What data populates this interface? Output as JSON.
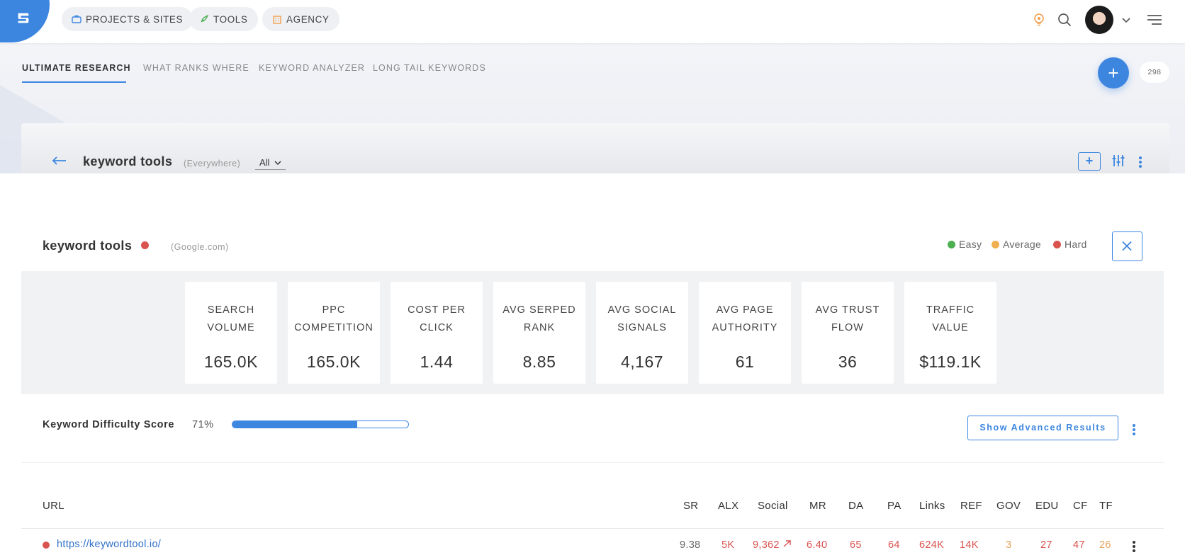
{
  "colors": {
    "accent": "#3d86e0",
    "easy": "#4caf50",
    "average": "#f0b04f",
    "hard": "#d9534f",
    "hard_text": "#d9534f",
    "avg_text": "#e8a25a",
    "link": "#2f6fc8"
  },
  "topnav": {
    "logo_icon": "brand-logo-icon",
    "items": [
      {
        "label": "PROJECTS & SITES",
        "icon": "briefcase-icon"
      },
      {
        "label": "TOOLS",
        "icon": "rocket-icon"
      },
      {
        "label": "AGENCY",
        "icon": "building-icon"
      }
    ],
    "right_icons": [
      "lightbulb-icon",
      "search-icon",
      "avatar",
      "chevron-down-icon",
      "menu-icon"
    ]
  },
  "tabs": [
    "ULTIMATE RESEARCH",
    "WHAT RANKS WHERE",
    "KEYWORD ANALYZER",
    "LONG TAIL KEYWORDS"
  ],
  "active_tab": "ULTIMATE RESEARCH",
  "fab": {
    "label": "+",
    "badge": "298"
  },
  "search": {
    "query": "keyword tools",
    "location": "(Everywhere)",
    "filter": "All",
    "add_button": "+"
  },
  "panel": {
    "title": "keyword tools",
    "engine": "(Google.com)",
    "legend": [
      {
        "label": "Easy",
        "color": "#4caf50"
      },
      {
        "label": "Average",
        "color": "#f0b04f"
      },
      {
        "label": "Hard",
        "color": "#d9534f"
      }
    ],
    "stats": [
      {
        "label_line1": "SEARCH",
        "label_line2": "VOLUME",
        "value": "165.0K"
      },
      {
        "label_line1": "PPC",
        "label_line2": "COMPETITION",
        "value": "165.0K"
      },
      {
        "label_line1": "COST PER",
        "label_line2": "CLICK",
        "value": "1.44"
      },
      {
        "label_line1": "AVG SERPED",
        "label_line2": "RANK",
        "value": "8.85"
      },
      {
        "label_line1": "AVG SOCIAL",
        "label_line2": "SIGNALS",
        "value": "4,167"
      },
      {
        "label_line1": "AVG PAGE",
        "label_line2": "AUTHORITY",
        "value": "61"
      },
      {
        "label_line1": "AVG TRUST",
        "label_line2": "FLOW",
        "value": "36"
      },
      {
        "label_line1": "TRAFFIC",
        "label_line2": "VALUE",
        "value": "$119.1K"
      }
    ],
    "difficulty": {
      "label": "Keyword Difficulty Score",
      "value_text": "71%",
      "fraction": 0.71
    },
    "advanced_button": "Show Advanced Results"
  },
  "table": {
    "columns": [
      "URL",
      "SR",
      "ALX",
      "Social",
      "MR",
      "DA",
      "PA",
      "Links",
      "REF",
      "GOV",
      "EDU",
      "CF",
      "TF"
    ],
    "rows": [
      {
        "url": "https://keywordtool.io/",
        "sr": "9.38",
        "alx": "5K",
        "social": "9,362",
        "social_icon": "trend-up-icon",
        "mr": "6.40",
        "da": "65",
        "pa": "64",
        "links": "624K",
        "ref": "14K",
        "gov": "3",
        "edu": "27",
        "cf": "47",
        "tf": "26"
      }
    ]
  }
}
